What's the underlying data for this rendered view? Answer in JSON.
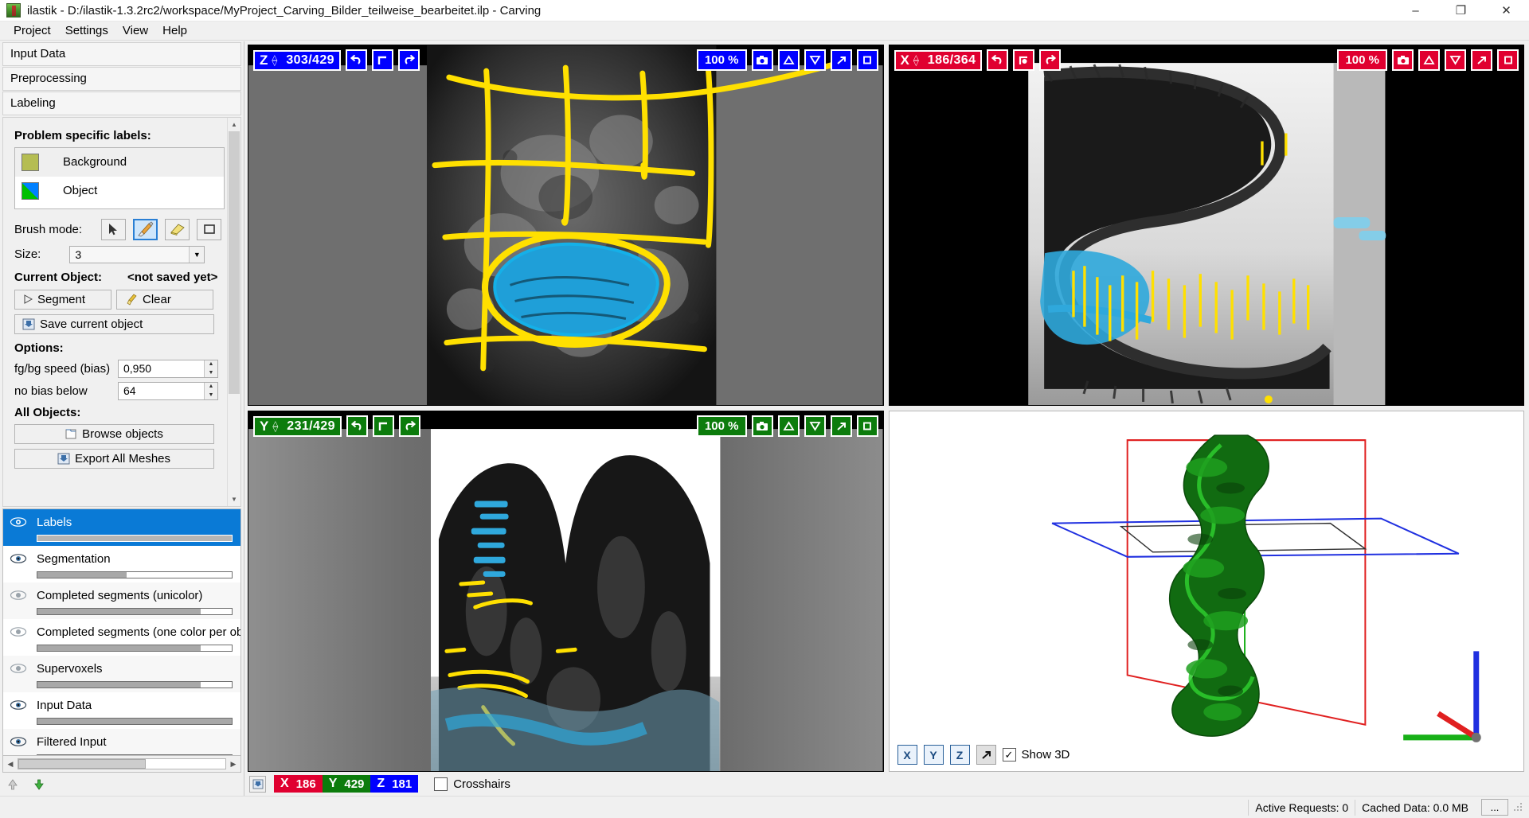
{
  "window": {
    "title": "ilastik - D:/ilastik-1.3.2rc2/workspace/MyProject_Carving_Bilder_teilweise_bearbeitet.ilp - Carving",
    "minimize": "–",
    "maximize": "❐",
    "close": "✕"
  },
  "menubar": {
    "items": [
      "Project",
      "Settings",
      "View",
      "Help"
    ]
  },
  "applets": [
    {
      "label": "Input Data"
    },
    {
      "label": "Preprocessing"
    },
    {
      "label": "Labeling"
    }
  ],
  "labeling": {
    "section_title": "Problem specific labels:",
    "labels": [
      {
        "name": "Background",
        "color": "#b5bd52",
        "selected": true
      },
      {
        "name": "Object",
        "color": "#00c000",
        "color2": "#0080ff",
        "selected": false
      }
    ],
    "brush_mode_label": "Brush mode:",
    "brush_modes": [
      {
        "name": "arrow-tool",
        "active": false
      },
      {
        "name": "paint-brush-tool",
        "active": true
      },
      {
        "name": "eraser-tool",
        "active": false
      },
      {
        "name": "rectangle-tool",
        "active": false
      }
    ],
    "size_label": "Size:",
    "size_value": "3",
    "current_object_label": "Current Object:",
    "current_object_value": "<not saved yet>",
    "segment_button": "Segment",
    "clear_button": "Clear",
    "save_object_button": "Save current object",
    "options_title": "Options:",
    "options": [
      {
        "label": "fg/bg speed (bias)",
        "value": "0,950"
      },
      {
        "label": "no bias below",
        "value": "64"
      }
    ],
    "all_objects_title": "All Objects:",
    "browse_button": "Browse objects",
    "export_button": "Export All Meshes"
  },
  "layers": [
    {
      "name": "Labels",
      "visible": true,
      "opacity": 100,
      "selected": true
    },
    {
      "name": "Segmentation",
      "visible": true,
      "opacity": 46,
      "selected": false
    },
    {
      "name": "Completed segments (unicolor)",
      "visible": false,
      "opacity": 84,
      "selected": false
    },
    {
      "name": "Completed segments (one color per ob",
      "visible": false,
      "opacity": 84,
      "selected": false
    },
    {
      "name": "Supervoxels",
      "visible": false,
      "opacity": 84,
      "selected": false
    },
    {
      "name": "Input Data",
      "visible": true,
      "opacity": 100,
      "selected": false
    },
    {
      "name": "Filtered Input",
      "visible": true,
      "opacity": 100,
      "selected": false
    }
  ],
  "viewports": [
    {
      "id": "z-view",
      "axis": "Z",
      "slice": "303/429",
      "zoom": "100 %",
      "color": "#0000ff",
      "color_name": "blue",
      "buttons": [
        "undo-icon",
        "reset-icon",
        "redo-icon"
      ],
      "right_buttons": [
        "screenshot-icon",
        "up-triangle-icon",
        "down-triangle-icon",
        "maximize-arrow-icon",
        "fit-square-icon"
      ]
    },
    {
      "id": "x-view",
      "axis": "X",
      "slice": "186/364",
      "zoom": "100 %",
      "color": "#e00030",
      "color_name": "red",
      "buttons": [
        "undo-icon",
        "reset-icon",
        "redo-icon"
      ],
      "right_buttons": [
        "screenshot-icon",
        "up-triangle-icon",
        "down-triangle-icon",
        "maximize-arrow-icon",
        "fit-square-icon"
      ]
    },
    {
      "id": "y-view",
      "axis": "Y",
      "slice": "231/429",
      "zoom": "100 %",
      "color": "#0c7c0c",
      "color_name": "green",
      "buttons": [
        "undo-icon",
        "reset-icon",
        "redo-icon"
      ],
      "right_buttons": [
        "screenshot-icon",
        "up-triangle-icon",
        "down-triangle-icon",
        "maximize-arrow-icon",
        "fit-square-icon"
      ]
    }
  ],
  "three_d": {
    "buttons": [
      "x-axis-button",
      "y-axis-button",
      "z-axis-button",
      "maximize-arrow-icon"
    ],
    "x_label": "X",
    "y_label": "Y",
    "z_label": "Z",
    "show3d_label": "Show 3D",
    "show3d_checked": true,
    "checkmark": "✓"
  },
  "position_bar": {
    "x": {
      "label": "X",
      "value": "186",
      "color": "#e00030"
    },
    "y": {
      "label": "Y",
      "value": "429",
      "color": "#0c7c0c"
    },
    "z": {
      "label": "Z",
      "value": "181",
      "color": "#0000ff"
    },
    "crosshairs_label": "Crosshairs",
    "crosshairs_checked": false
  },
  "statusbar": {
    "active_requests": "Active Requests: 0",
    "cached_data": "Cached Data: 0.0 MB",
    "more_button": "..."
  }
}
